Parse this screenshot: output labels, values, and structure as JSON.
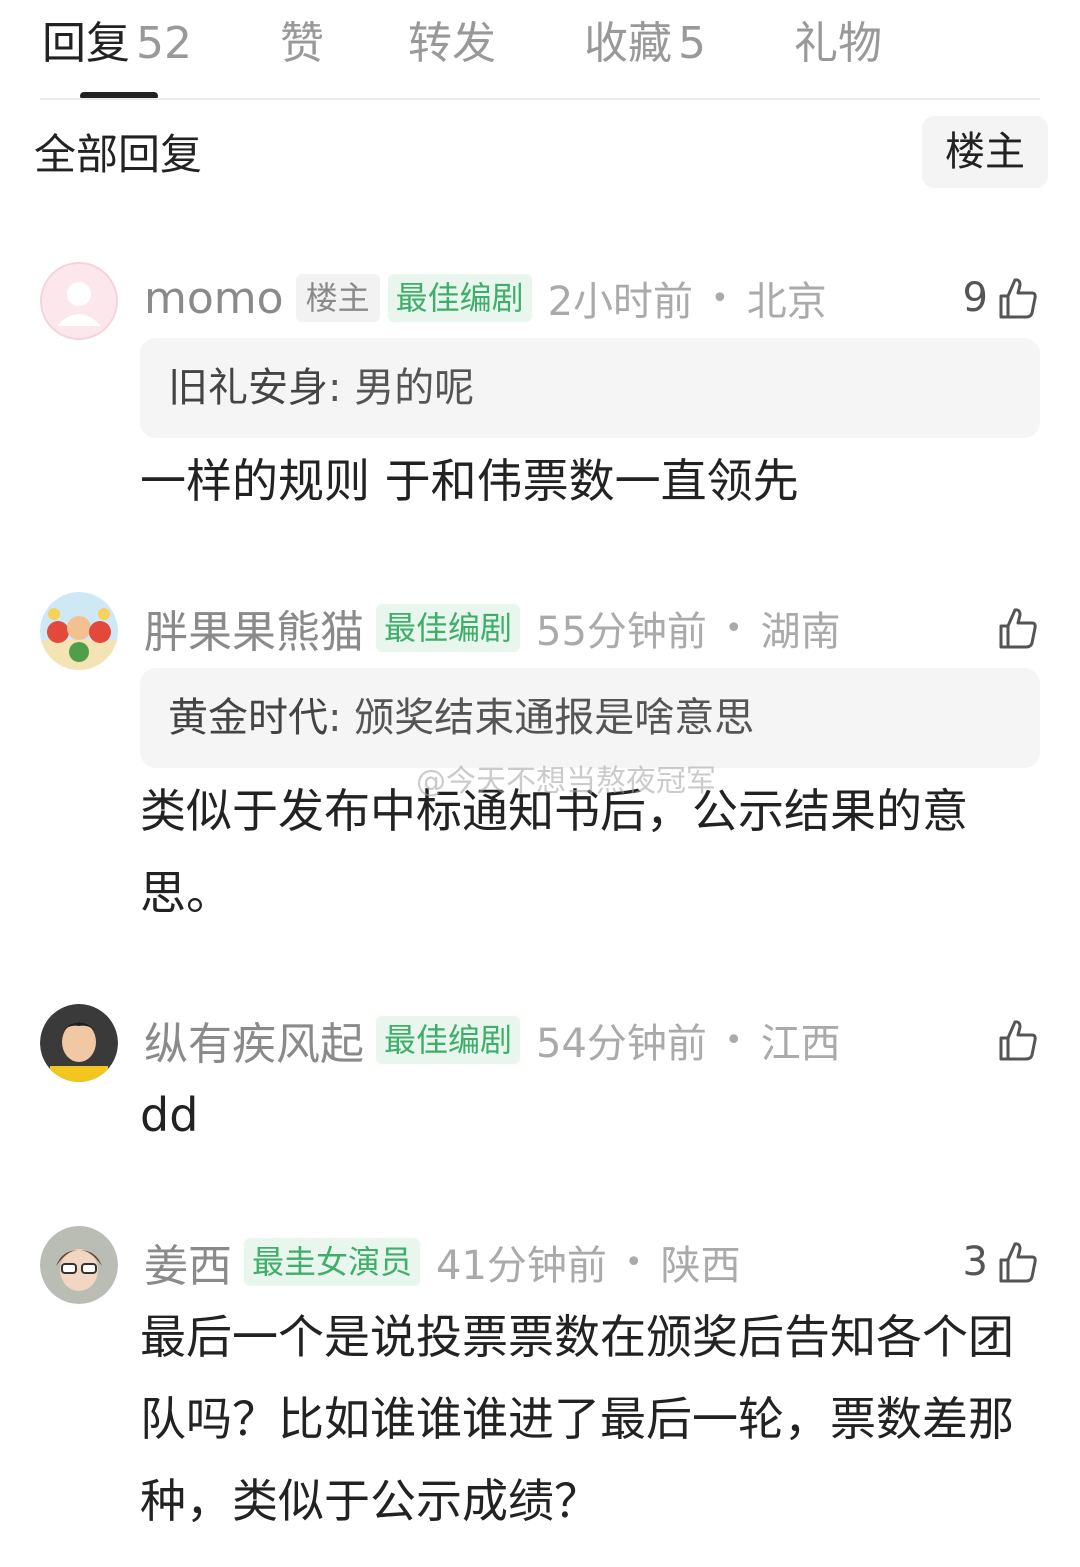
{
  "tabs": [
    {
      "label": "回复",
      "count": "52",
      "active": true
    },
    {
      "label": "赞",
      "count": "",
      "active": false
    },
    {
      "label": "转发",
      "count": "",
      "active": false
    },
    {
      "label": "收藏",
      "count": "5",
      "active": false
    },
    {
      "label": "礼物",
      "count": "",
      "active": false
    }
  ],
  "filter": {
    "label": "全部回复",
    "op_button": "楼主"
  },
  "comments": [
    {
      "username": "momo",
      "op_badge": "楼主",
      "award": "最佳编剧",
      "time": "2小时前",
      "location": "北京",
      "likes": "9",
      "quote_name": "旧礼安身",
      "quote_text": "男的呢",
      "body": "一样的规则 于和伟票数一直领先"
    },
    {
      "username": "胖果果熊猫",
      "award": "最佳编剧",
      "time": "55分钟前",
      "location": "湖南",
      "likes": "",
      "quote_name": "黄金时代",
      "quote_text": "颁奖结束通报是啥意思",
      "body": "类似于发布中标通知书后，公示结果的意思。"
    },
    {
      "username": "纵有疾风起",
      "award": "最佳编剧",
      "time": "54分钟前",
      "location": "江西",
      "likes": "",
      "body": "dd"
    },
    {
      "username": "姜西",
      "award": "最圭女演员",
      "time": "41分钟前",
      "location": "陕西",
      "likes": "3",
      "body": "最后一个是说投票票数在颁奖后告知各个团队吗？比如谁谁谁进了最后一轮，票数差那种，类似于公示成绩？"
    }
  ],
  "separator": "•",
  "quote_colon": ":",
  "watermark": "@今天不想当熬夜冠军",
  "colors": {
    "award_green": "#3fae6a",
    "award_bg": "#e8f6ed",
    "muted": "#8a8a8a"
  }
}
